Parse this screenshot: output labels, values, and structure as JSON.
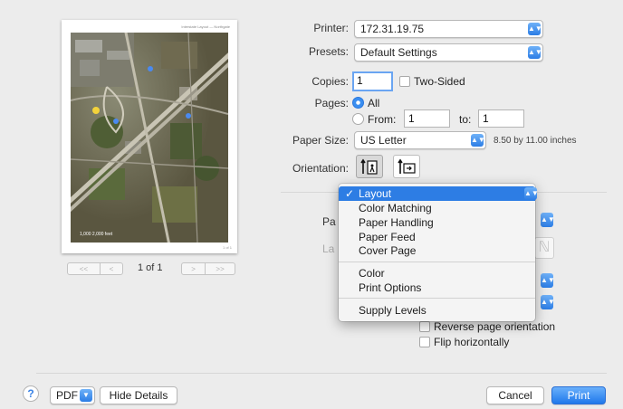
{
  "preview": {
    "caption": "Interstate Layout — Northgate",
    "scale_label": "1,000     2,000 feet",
    "page_num": "1 of 1",
    "page_count": "1 of 1",
    "first_glyph": "<<",
    "prev_glyph": "<",
    "next_glyph": ">",
    "last_glyph": ">>"
  },
  "printer": {
    "label": "Printer:",
    "value": "172.31.19.75"
  },
  "presets": {
    "label": "Presets:",
    "value": "Default Settings"
  },
  "copies": {
    "label": "Copies:",
    "value": "1",
    "two_sided_label": "Two-Sided"
  },
  "pages": {
    "label": "Pages:",
    "all_label": "All",
    "from_label": "From:",
    "from_value": "1",
    "to_label": "to:",
    "to_value": "1",
    "selected": "All"
  },
  "paper_size": {
    "label": "Paper Size:",
    "value": "US Letter",
    "dimensions": "8.50 by 11.00 inches"
  },
  "orientation": {
    "label": "Orientation:",
    "selected": "portrait"
  },
  "hidden_labels": {
    "pages_per_sheet_fragment": "Pa",
    "layout_direction_fragment": "La"
  },
  "panel_menu": {
    "check": "✓",
    "selected": "Layout",
    "items": [
      "Layout",
      "Color Matching",
      "Paper Handling",
      "Paper Feed",
      "Cover Page",
      "Color",
      "Print Options",
      "Supply Levels"
    ]
  },
  "layout_options": {
    "reverse_label": "Reverse page orientation",
    "flip_label": "Flip horizontally"
  },
  "footer": {
    "help_glyph": "?",
    "pdf_label": "PDF",
    "hide_details_label": "Hide Details",
    "cancel_label": "Cancel",
    "print_label": "Print"
  },
  "icons": {
    "popup_arrow": "chevron-up-down-icon",
    "portrait": "portrait-orientation-icon",
    "landscape": "landscape-orientation-icon"
  },
  "colors": {
    "accent": "#2d7de4",
    "window_bg": "#ececec"
  }
}
